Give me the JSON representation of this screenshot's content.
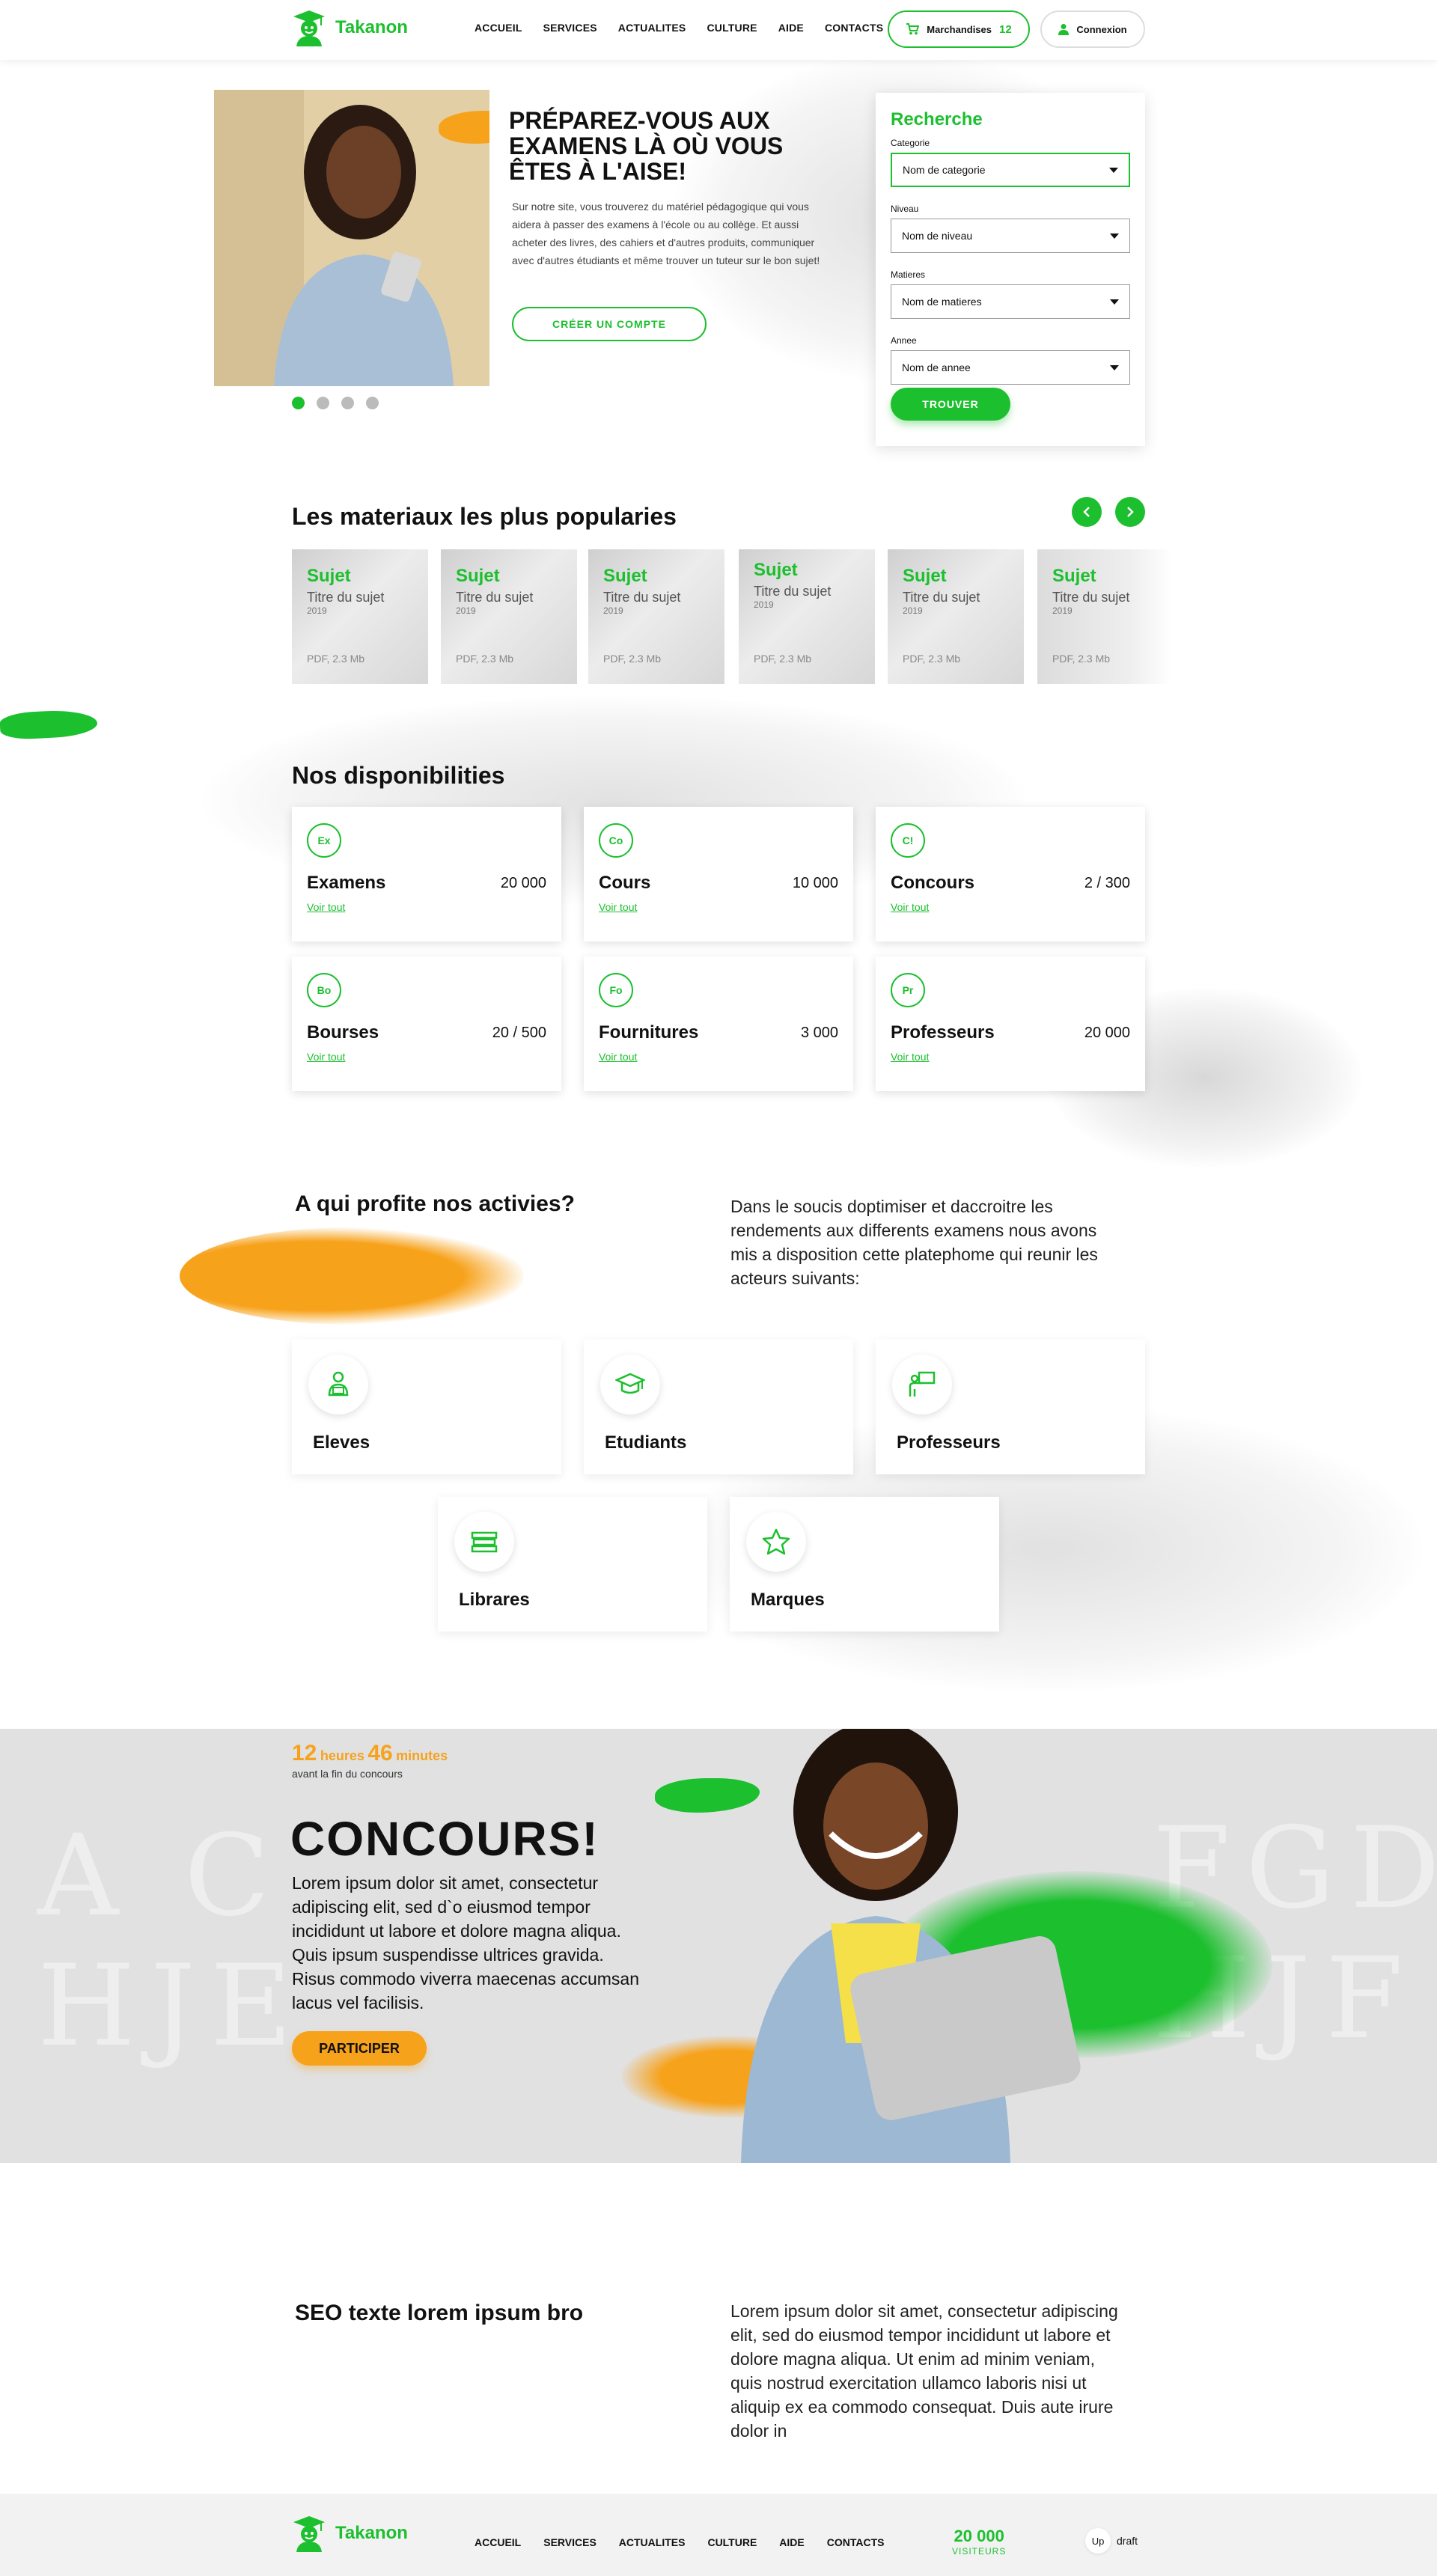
{
  "brand": {
    "name": "Takanon",
    "green": "#1cbf2e",
    "orange": "#f7a21b"
  },
  "nav": [
    "ACCUEIL",
    "SERVICES",
    "ACTUALITES",
    "CULTURE",
    "AIDE",
    "CONTACTS"
  ],
  "header": {
    "cart_label": "Marchandises",
    "cart_count": "12",
    "login_label": "Connexion",
    "cart_icon": "cart-icon",
    "login_icon": "user-icon"
  },
  "hero": {
    "title": "PRÉPAREZ-VOUS AUX EXAMENS LÀ OÙ VOUS ÊTES À L'AISE!",
    "text": "Sur notre site, vous trouverez du matériel pédagogique qui vous aidera à passer des examens à l'école ou au collège. Et aussi acheter des livres, des cahiers et d'autres produits, communiquer avec d'autres étudiants et même trouver un tuteur sur le bon sujet!",
    "cta": "CRÉER UN COMPTE",
    "active_slide": 1,
    "slide_count": 4
  },
  "search": {
    "title": "Recherche",
    "fields": [
      {
        "label": "Categorie",
        "value": "Nom de categorie"
      },
      {
        "label": "Niveau",
        "value": "Nom de niveau"
      },
      {
        "label": "Matieres",
        "value": "Nom de matieres"
      },
      {
        "label": "Annee",
        "value": "Nom de annee"
      }
    ],
    "button": "TROUVER"
  },
  "popular": {
    "title": "Les materiaux les plus popularies",
    "items": [
      {
        "type": "Sujet",
        "title": "Titre du sujet",
        "year": "2019",
        "meta": "PDF, 2.3 Mb"
      },
      {
        "type": "Sujet",
        "title": "Titre du sujet",
        "year": "2019",
        "meta": "PDF, 2.3 Mb"
      },
      {
        "type": "Sujet",
        "title": "Titre du sujet",
        "year": "2019",
        "meta": "PDF, 2.3 Mb"
      },
      {
        "type": "Sujet",
        "title": "Titre du sujet",
        "year": "2019",
        "meta": "PDF, 2.3 Mb"
      },
      {
        "type": "Sujet",
        "title": "Titre du sujet",
        "year": "2019",
        "meta": "PDF, 2.3 Mb"
      },
      {
        "type": "Sujet",
        "title": "Titre du sujet",
        "year": "2019",
        "meta": "PDF, 2.3 Mb"
      }
    ]
  },
  "availability": {
    "title": "Nos disponibilities",
    "link_label": "Voir tout",
    "items": [
      {
        "badge": "Ex",
        "name": "Examens",
        "count": "20 000"
      },
      {
        "badge": "Co",
        "name": "Cours",
        "count": "10 000"
      },
      {
        "badge": "C!",
        "name": "Concours",
        "count": "2 / 300"
      },
      {
        "badge": "Bo",
        "name": "Bourses",
        "count": "20 / 500"
      },
      {
        "badge": "Fo",
        "name": "Fournitures",
        "count": "3 000"
      },
      {
        "badge": "Pr",
        "name": "Professeurs",
        "count": "20 000"
      }
    ]
  },
  "benefits": {
    "title": "A qui profite nos activies?",
    "text": "Dans le soucis doptimiser et daccroitre les rendements aux differents examens nous avons mis a disposition cette platephome qui reunir les acteurs suivants:",
    "items": [
      {
        "name": "Eleves",
        "icon": "pupil-icon"
      },
      {
        "name": "Etudiants",
        "icon": "graduation-cap-icon"
      },
      {
        "name": "Professeurs",
        "icon": "teacher-board-icon"
      },
      {
        "name": "Librares",
        "icon": "books-icon"
      },
      {
        "name": "Marques",
        "icon": "star-icon"
      }
    ]
  },
  "concours": {
    "hours": "12",
    "hours_label": "heures",
    "minutes": "46",
    "minutes_label": "minutes",
    "subtitle": "avant la fin du concours",
    "title": "CONCOURS!",
    "text": "Lorem ipsum dolor sit amet, consectetur adipiscing elit, sed d`o eiusmod tempor incididunt ut labore et dolore magna aliqua. Quis ipsum suspendisse ultrices gravida. Risus commodo viverra maecenas accumsan lacus vel facilisis.",
    "cta": "PARTICIPER"
  },
  "seo": {
    "title": "SEO texte lorem ipsum bro",
    "text": "Lorem ipsum dolor sit amet, consectetur adipiscing elit, sed do eiusmod tempor incididunt ut labore et dolore magna aliqua. Ut enim ad minim veniam, quis nostrud exercitation ullamco laboris nisi ut aliquip ex ea commodo consequat. Duis aute irure dolor in"
  },
  "footer": {
    "visitors_count": "20 000",
    "visitors_label": "VISITEURS",
    "updraft_badge": "Up",
    "updraft_label": "draft"
  }
}
